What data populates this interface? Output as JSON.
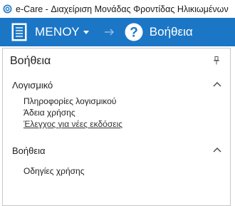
{
  "window": {
    "title": "e-Care - Διαχείριση Μονάδας Φροντίδας Ηλικιωμένων"
  },
  "ribbon": {
    "menu_label": "ΜΕΝΟΥ",
    "current_label": "Βοήθεια",
    "background_color": "#1c76c6"
  },
  "panel": {
    "title": "Βοήθεια",
    "sections": [
      {
        "title": "Λογισμικό",
        "expanded": true,
        "items": [
          "Πληροφορίες λογισμικού",
          "Άδεια χρήσης",
          "Έλεγχος για νέες εκδόσεις"
        ]
      },
      {
        "title": "Βοήθεια",
        "expanded": true,
        "items": [
          "Οδηγίες χρήσης"
        ]
      }
    ]
  },
  "icons": {
    "app": "ecare-logo-icon",
    "menu": "document-icon",
    "dropdown": "caret-down-icon",
    "separator": "arrow-right-icon",
    "help": "question-circle-icon",
    "pin": "pin-icon",
    "collapse": "chevron-up-icon"
  }
}
